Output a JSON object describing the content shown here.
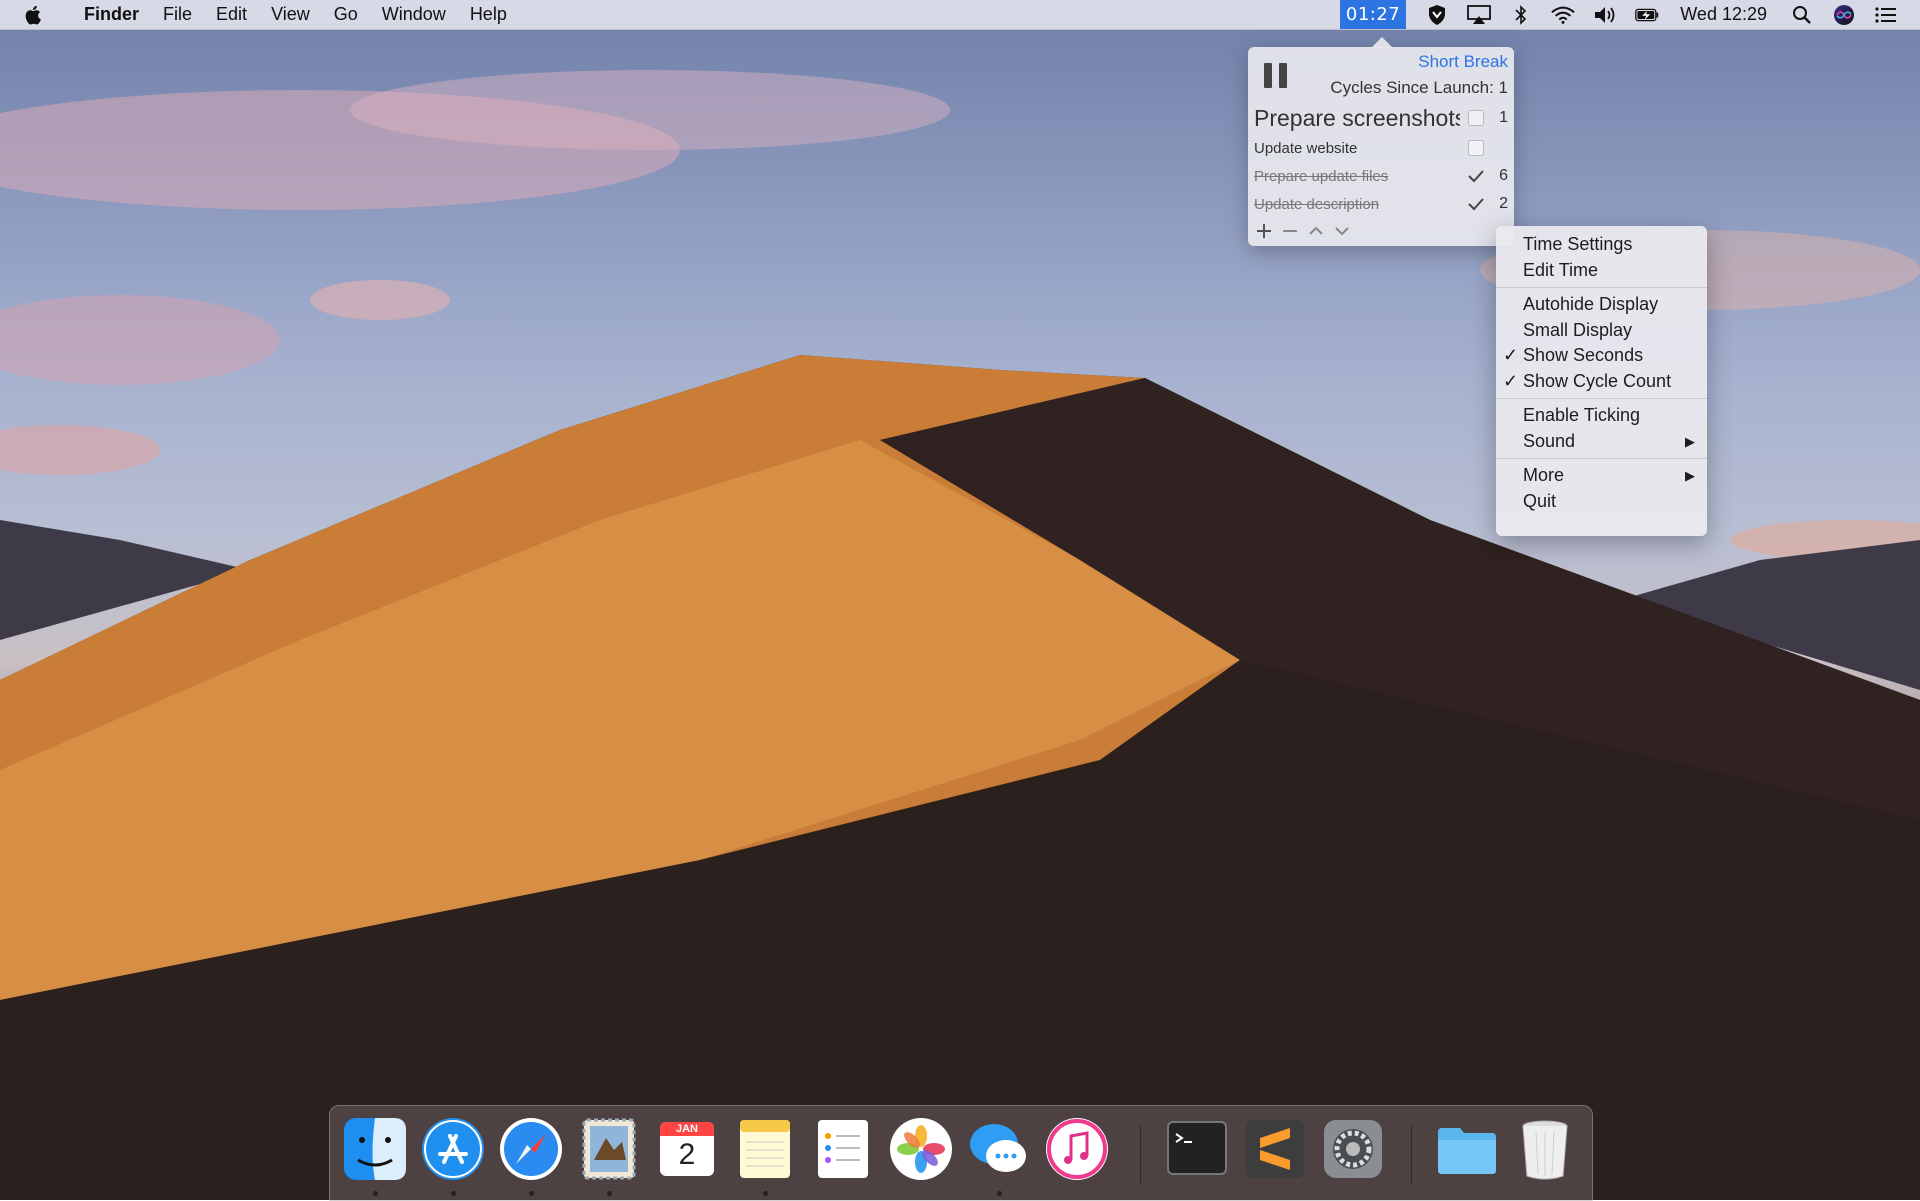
{
  "menubar": {
    "app_name": "Finder",
    "menus": [
      "File",
      "Edit",
      "View",
      "Go",
      "Window",
      "Help"
    ],
    "timer": "01:27",
    "clock": "Wed 12:29",
    "status_icons": [
      "privacy-shield-icon",
      "airplay-icon",
      "bluetooth-icon",
      "wifi-icon",
      "volume-icon",
      "battery-icon",
      "search-icon",
      "siri-icon",
      "notification-center-icon"
    ]
  },
  "popover": {
    "status": "Short Break",
    "cycles": "Cycles Since Launch: 1",
    "tasks": [
      {
        "name": "Prepare screenshots",
        "done": false,
        "count": "1"
      },
      {
        "name": "Update website",
        "done": false,
        "count": ""
      },
      {
        "name": "Prepare update files",
        "done": true,
        "count": "6"
      },
      {
        "name": "Update description",
        "done": true,
        "count": "2"
      }
    ],
    "tools": [
      "add-icon",
      "remove-icon",
      "move-up-icon",
      "move-down-icon"
    ]
  },
  "context_menu": {
    "groups": [
      [
        {
          "label": "Time Settings",
          "checked": false,
          "submenu": false
        },
        {
          "label": "Edit Time",
          "checked": false,
          "submenu": false
        }
      ],
      [
        {
          "label": "Autohide Display",
          "checked": false,
          "submenu": false
        },
        {
          "label": "Small Display",
          "checked": false,
          "submenu": false
        },
        {
          "label": "Show Seconds",
          "checked": true,
          "submenu": false
        },
        {
          "label": "Show Cycle Count",
          "checked": true,
          "submenu": false
        }
      ],
      [
        {
          "label": "Enable Ticking",
          "checked": false,
          "submenu": false
        },
        {
          "label": "Sound",
          "checked": false,
          "submenu": true
        }
      ],
      [
        {
          "label": "More",
          "checked": false,
          "submenu": true
        },
        {
          "label": "Quit",
          "checked": false,
          "submenu": false
        }
      ]
    ]
  },
  "dock": {
    "calendar_month": "JAN",
    "calendar_day": "2",
    "apps": [
      {
        "name": "finder-icon",
        "running": true
      },
      {
        "name": "app-store-icon",
        "running": true
      },
      {
        "name": "safari-icon",
        "running": true
      },
      {
        "name": "mail-icon",
        "running": true
      },
      {
        "name": "calendar-icon",
        "running": false
      },
      {
        "name": "notes-icon",
        "running": true
      },
      {
        "name": "reminders-icon",
        "running": false
      },
      {
        "name": "photos-icon",
        "running": false
      },
      {
        "name": "messages-icon",
        "running": true
      },
      {
        "name": "itunes-icon",
        "running": false
      },
      {
        "name": "terminal-icon",
        "running": false
      },
      {
        "name": "sublime-text-icon",
        "running": false
      },
      {
        "name": "system-preferences-icon",
        "running": false
      },
      {
        "name": "folder-icon",
        "running": false
      },
      {
        "name": "trash-icon",
        "running": false
      }
    ]
  }
}
